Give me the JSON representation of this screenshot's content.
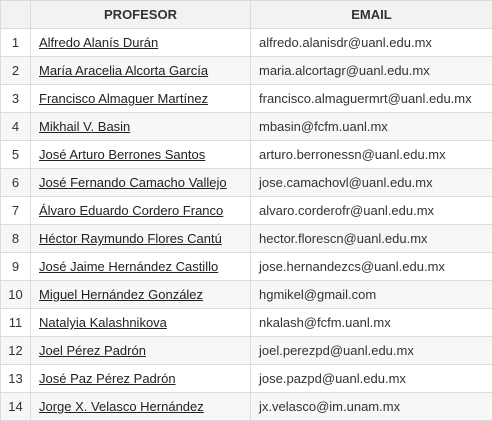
{
  "table": {
    "headers": {
      "number": "",
      "profesor": "PROFESOR",
      "email": "EMAIL"
    },
    "rows": [
      {
        "num": "1",
        "name": "Alfredo Alanís Durán",
        "email": "alfredo.alanisdr@uanl.edu.mx"
      },
      {
        "num": "2",
        "name": "María Aracelia Alcorta García",
        "email": "maria.alcortagr@uanl.edu.mx"
      },
      {
        "num": "3",
        "name": "Francisco Almaguer Martínez",
        "email": "francisco.almaguermrt@uanl.edu.mx"
      },
      {
        "num": "4",
        "name": "Mikhail V. Basin",
        "email": "mbasin@fcfm.uanl.mx"
      },
      {
        "num": "5",
        "name": "José Arturo Berrones Santos",
        "email": "arturo.berronessn@uanl.edu.mx"
      },
      {
        "num": "6",
        "name": "José Fernando Camacho Vallejo",
        "email": "jose.camachovl@uanl.edu.mx"
      },
      {
        "num": "7",
        "name": "Álvaro Eduardo Cordero Franco",
        "email": "alvaro.corderofr@uanl.edu.mx"
      },
      {
        "num": "8",
        "name": "Héctor Raymundo Flores Cantú",
        "email": "hector.florescn@uanl.edu.mx"
      },
      {
        "num": "9",
        "name": "José Jaime Hernández Castillo",
        "email": "jose.hernandezcs@uanl.edu.mx"
      },
      {
        "num": "10",
        "name": "Miguel Hernández González",
        "email": "hgmikel@gmail.com"
      },
      {
        "num": "11",
        "name": "Natalyia Kalashnikova",
        "email": "nkalash@fcfm.uanl.mx"
      },
      {
        "num": "12",
        "name": "Joel Pérez Padrón",
        "email": "joel.perezpd@uanl.edu.mx"
      },
      {
        "num": "13",
        "name": "José Paz Pérez Padrón",
        "email": "jose.pazpd@uanl.edu.mx"
      },
      {
        "num": "14",
        "name": "Jorge X. Velasco Hernández",
        "email": "jx.velasco@im.unam.mx"
      }
    ]
  }
}
